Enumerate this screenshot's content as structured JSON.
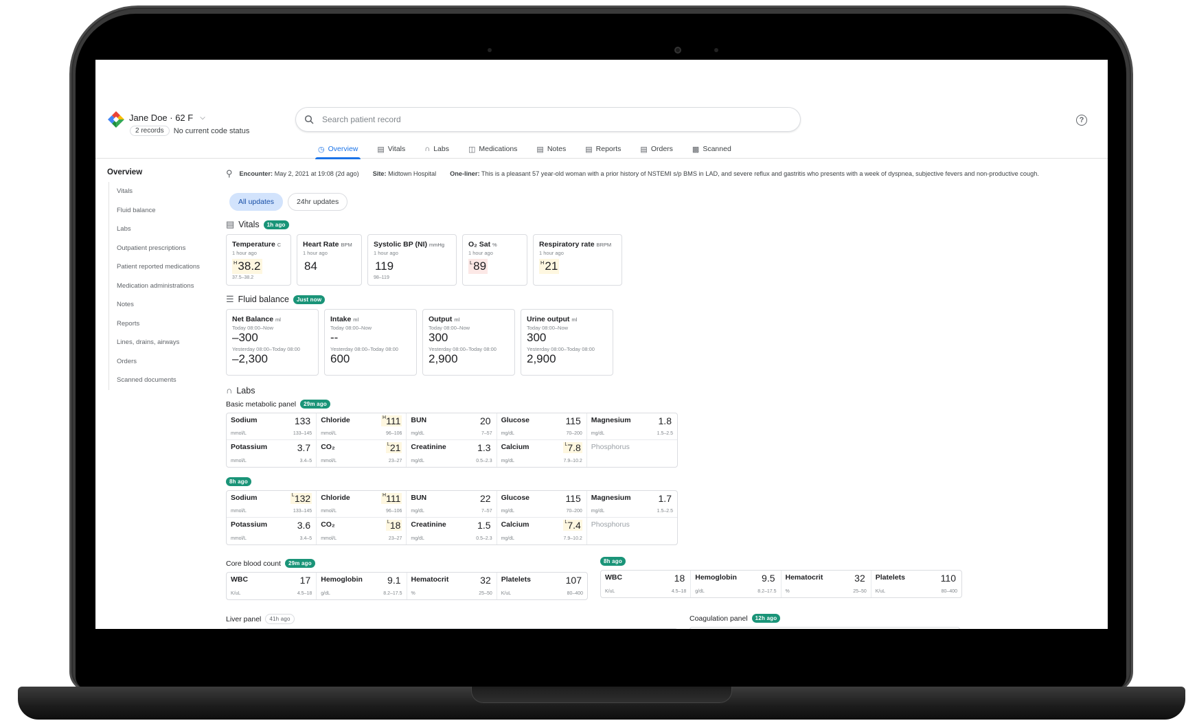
{
  "header": {
    "patient_name": "Jane Doe · 62 F",
    "records_chip": "2 records",
    "code_status": "No current code status",
    "search_placeholder": "Search patient record",
    "help_icon": "?"
  },
  "tabs": [
    {
      "label": "Overview",
      "icon": "overview-icon",
      "active": true
    },
    {
      "label": "Vitals",
      "icon": "vitals-icon"
    },
    {
      "label": "Labs",
      "icon": "test-tube-icon"
    },
    {
      "label": "Medications",
      "icon": "medications-icon"
    },
    {
      "label": "Notes",
      "icon": "notes-icon"
    },
    {
      "label": "Reports",
      "icon": "reports-icon"
    },
    {
      "label": "Orders",
      "icon": "orders-icon"
    },
    {
      "label": "Scanned",
      "icon": "scanned-icon"
    }
  ],
  "sidebar": {
    "title": "Overview",
    "items": [
      "Vitals",
      "Fluid balance",
      "Labs",
      "Outpatient prescriptions",
      "Patient reported medications",
      "Medication administrations",
      "Notes",
      "Reports",
      "Lines, drains, airways",
      "Orders",
      "Scanned documents"
    ]
  },
  "encounter": {
    "encounter_label": "Encounter:",
    "encounter_value": "May 2, 2021 at 19:08 (2d ago)",
    "site_label": "Site:",
    "site_value": "Midtown Hospital",
    "oneliner_label": "One-liner:",
    "oneliner_value": "This is a pleasant 57 year-old woman with a prior history of NSTEMI s/p BMS in LAD, and severe reflux and gastritis who presents with a week of dyspnea, subjective fevers and non-productive cough."
  },
  "filters": [
    "All updates",
    "24hr updates"
  ],
  "vitals": {
    "title": "Vitals",
    "badge": "1h ago",
    "cards": [
      {
        "title": "Temperature",
        "unit": "C",
        "time": "1 hour ago",
        "flag": "H",
        "value": "38.2",
        "status": "high",
        "range": "37.5–38.2"
      },
      {
        "title": "Heart Rate",
        "unit": "BPM",
        "time": "1 hour ago",
        "flag": "",
        "value": "84",
        "status": "",
        "range": ""
      },
      {
        "title": "Systolic BP (NI)",
        "unit": "mmHg",
        "time": "1 hour ago",
        "flag": "",
        "value": "119",
        "status": "",
        "range": "98–119"
      },
      {
        "title": "O₂ Sat",
        "unit": "%",
        "time": "1 hour ago",
        "flag": "L",
        "value": "89",
        "status": "low",
        "range": ""
      },
      {
        "title": "Respiratory rate",
        "unit": "BRPM",
        "time": "1 hour ago",
        "flag": "H",
        "value": "21",
        "status": "high",
        "range": ""
      }
    ]
  },
  "fluid": {
    "title": "Fluid balance",
    "badge": "Just now",
    "cards": [
      {
        "title": "Net Balance",
        "unit": "ml",
        "today_label": "Today 08:00–Now",
        "today_value": "–300",
        "yday_label": "Yesterday 08:00–Today 08:00",
        "yday_value": "–2,300"
      },
      {
        "title": "Intake",
        "unit": "ml",
        "today_label": "Today 08:00–Now",
        "today_value": "--",
        "yday_label": "Yesterday 08:00–Today 08:00",
        "yday_value": "600"
      },
      {
        "title": "Output",
        "unit": "ml",
        "today_label": "Today 08:00–Now",
        "today_value": "300",
        "yday_label": "Yesterday 08:00–Today 08:00",
        "yday_value": "2,900"
      },
      {
        "title": "Urine output",
        "unit": "ml",
        "today_label": "Today 08:00–Now",
        "today_value": "300",
        "yday_label": "Yesterday 08:00–Today 08:00",
        "yday_value": "2,900"
      }
    ]
  },
  "labs": {
    "title": "Labs",
    "bmp_label": "Basic metabolic panel",
    "bmp_sets": [
      {
        "badge": "29m ago",
        "cells": [
          {
            "name": "Sodium",
            "unit": "mmol/L",
            "value": "133",
            "flag": "",
            "range": "133–145"
          },
          {
            "name": "Chloride",
            "unit": "mmol/L",
            "value": "111",
            "flag": "H",
            "range": "96–106"
          },
          {
            "name": "BUN",
            "unit": "mg/dL",
            "value": "20",
            "flag": "",
            "range": "7–57"
          },
          {
            "name": "Glucose",
            "unit": "mg/dL",
            "value": "115",
            "flag": "",
            "range": "70–200"
          },
          {
            "name": "Magnesium",
            "unit": "mg/dL",
            "value": "1.8",
            "flag": "",
            "range": "1.5–2.5"
          },
          {
            "name": "Potassium",
            "unit": "mmol/L",
            "value": "3.7",
            "flag": "",
            "range": "3.4–5"
          },
          {
            "name": "CO₂",
            "unit": "mmol/L",
            "value": "21",
            "flag": "L",
            "range": "23–27"
          },
          {
            "name": "Creatinine",
            "unit": "mg/dL",
            "value": "1.3",
            "flag": "",
            "range": "0.5–2.3"
          },
          {
            "name": "Calcium",
            "unit": "mg/dL",
            "value": "7.8",
            "flag": "L",
            "range": "7.9–10.2"
          },
          {
            "name": "Phosphorus",
            "unit": "",
            "value": "",
            "flag": "",
            "range": "",
            "dim": true
          }
        ]
      },
      {
        "badge": "8h ago",
        "cells": [
          {
            "name": "Sodium",
            "unit": "mmol/L",
            "value": "132",
            "flag": "L",
            "range": "133–145"
          },
          {
            "name": "Chloride",
            "unit": "mmol/L",
            "value": "111",
            "flag": "H",
            "range": "96–106"
          },
          {
            "name": "BUN",
            "unit": "mg/dL",
            "value": "22",
            "flag": "",
            "range": "7–57"
          },
          {
            "name": "Glucose",
            "unit": "mg/dL",
            "value": "115",
            "flag": "",
            "range": "70–200"
          },
          {
            "name": "Magnesium",
            "unit": "mg/dL",
            "value": "1.7",
            "flag": "",
            "range": "1.5–2.5"
          },
          {
            "name": "Potassium",
            "unit": "mmol/L",
            "value": "3.6",
            "flag": "",
            "range": "3.4–5"
          },
          {
            "name": "CO₂",
            "unit": "mmol/L",
            "value": "18",
            "flag": "L",
            "range": "23–27"
          },
          {
            "name": "Creatinine",
            "unit": "mg/dL",
            "value": "1.5",
            "flag": "",
            "range": "0.5–2.3"
          },
          {
            "name": "Calcium",
            "unit": "mg/dL",
            "value": "7.4",
            "flag": "L",
            "range": "7.9–10.2"
          },
          {
            "name": "Phosphorus",
            "unit": "",
            "value": "",
            "flag": "",
            "range": "",
            "dim": true
          }
        ]
      }
    ],
    "cbc_label": "Core blood count",
    "cbc_sets": [
      {
        "badge": "29m ago",
        "cells": [
          {
            "name": "WBC",
            "unit": "K/uL",
            "value": "17",
            "flag": "",
            "range": "4.5–18"
          },
          {
            "name": "Hemoglobin",
            "unit": "g/dL",
            "value": "9.1",
            "flag": "",
            "range": "8.2–17.5"
          },
          {
            "name": "Hematocrit",
            "unit": "%",
            "value": "32",
            "flag": "",
            "range": "25–50"
          },
          {
            "name": "Platelets",
            "unit": "K/uL",
            "value": "107",
            "flag": "",
            "range": "80–400"
          }
        ]
      },
      {
        "badge": "8h ago",
        "cells": [
          {
            "name": "WBC",
            "unit": "K/uL",
            "value": "18",
            "flag": "",
            "range": "4.5–18"
          },
          {
            "name": "Hemoglobin",
            "unit": "g/dL",
            "value": "9.5",
            "flag": "",
            "range": "8.2–17.5"
          },
          {
            "name": "Hematocrit",
            "unit": "%",
            "value": "32",
            "flag": "",
            "range": "25–50"
          },
          {
            "name": "Platelets",
            "unit": "K/uL",
            "value": "110",
            "flag": "",
            "range": "80–400"
          }
        ]
      }
    ],
    "liver_label": "Liver panel",
    "liver_badge": "41h ago",
    "coag_label": "Coagulation panel",
    "coag_badge": "12h ago"
  }
}
